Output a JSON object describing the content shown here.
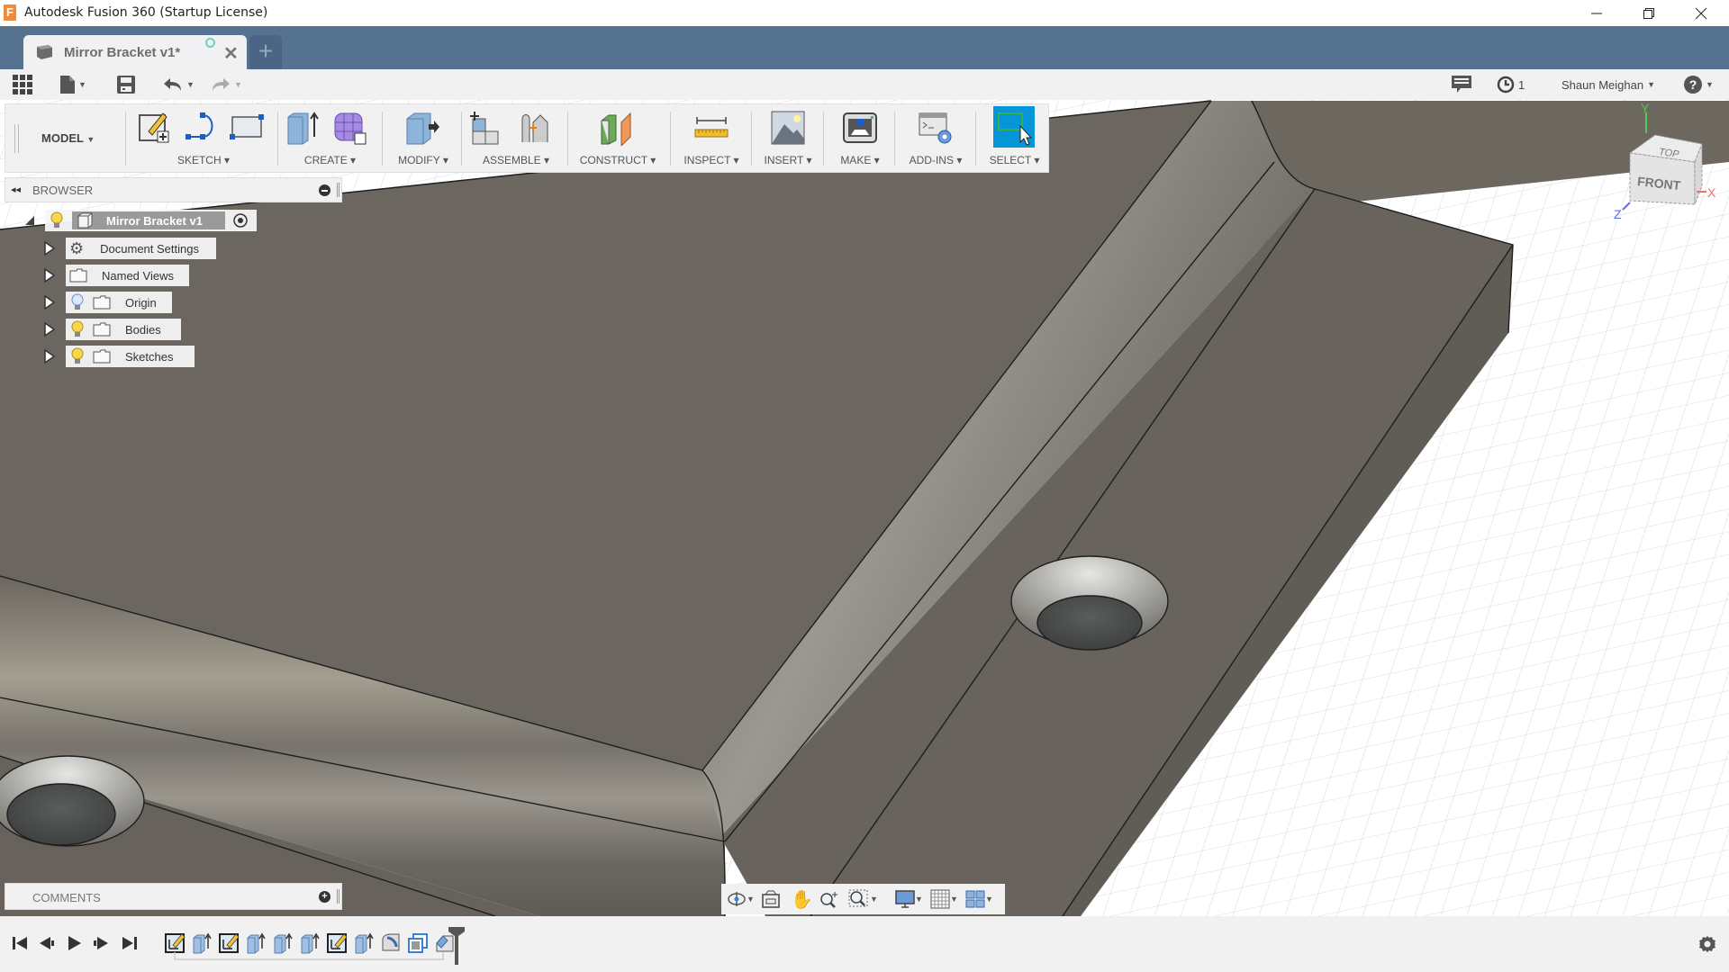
{
  "window": {
    "title": "Autodesk Fusion 360 (Startup License)",
    "logo_letter": "F",
    "controls": [
      "minimize",
      "restore",
      "close"
    ]
  },
  "tabs": [
    {
      "label": "Mirror Bracket v1*",
      "active": true,
      "status": "online-indicator",
      "close": "✕"
    }
  ],
  "new_tab_label": "+",
  "quick_access": {
    "left": [
      "data-panel-icon",
      "file-menu-icon",
      "save-icon",
      "undo-icon",
      "redo-icon"
    ],
    "job_status_count": "1",
    "user_name": "Shaun Meighan",
    "help": "?"
  },
  "toolbar": {
    "workspace": "MODEL",
    "groups": [
      {
        "label": "SKETCH",
        "icons": [
          "create-sketch-icon",
          "line-arc-icon",
          "rectangle-icon"
        ]
      },
      {
        "label": "CREATE",
        "icons": [
          "extrude-icon",
          "create-form-icon"
        ]
      },
      {
        "label": "MODIFY",
        "icons": [
          "press-pull-icon"
        ]
      },
      {
        "label": "ASSEMBLE",
        "icons": [
          "new-component-icon",
          "joint-icon"
        ]
      },
      {
        "label": "CONSTRUCT",
        "icons": [
          "offset-plane-icon"
        ]
      },
      {
        "label": "INSPECT",
        "icons": [
          "measure-icon"
        ]
      },
      {
        "label": "INSERT",
        "icons": [
          "insert-image-icon"
        ]
      },
      {
        "label": "MAKE",
        "icons": [
          "3d-print-icon"
        ]
      },
      {
        "label": "ADD-INS",
        "icons": [
          "scripts-addins-icon"
        ]
      },
      {
        "label": "SELECT",
        "icons": [
          "select-icon"
        ],
        "active": true
      }
    ]
  },
  "browser": {
    "title": "BROWSER",
    "root": "Mirror Bracket v1",
    "items": [
      {
        "label": "Document Settings",
        "icon": "gear-icon",
        "bulb": null
      },
      {
        "label": "Named Views",
        "icon": "folder-icon",
        "bulb": null
      },
      {
        "label": "Origin",
        "icon": "folder-icon",
        "bulb": "off"
      },
      {
        "label": "Bodies",
        "icon": "folder-icon",
        "bulb": "on"
      },
      {
        "label": "Sketches",
        "icon": "folder-icon",
        "bulb": "on"
      }
    ]
  },
  "viewcube": {
    "top": "TOP",
    "front": "FRONT",
    "x": "X",
    "y": "Y",
    "z": "Z"
  },
  "comments": {
    "title": "COMMENTS"
  },
  "navbar": [
    "orbit-icon",
    "look-at-icon",
    "pan-icon",
    "zoom-icon",
    "fit-icon",
    "display-settings-icon",
    "grid-snaps-icon",
    "viewports-icon"
  ],
  "timeline": {
    "controls": [
      "go-to-start",
      "previous-step",
      "play",
      "next-step",
      "go-to-end"
    ],
    "features": [
      "sketch",
      "extrude",
      "sketch",
      "extrude",
      "extrude",
      "extrude",
      "sketch",
      "extrude",
      "fillet",
      "shell",
      "chamfer"
    ]
  },
  "colors": {
    "tabbar": "#557290",
    "select_active": "#0696d7",
    "model_body": "#6b6760"
  }
}
